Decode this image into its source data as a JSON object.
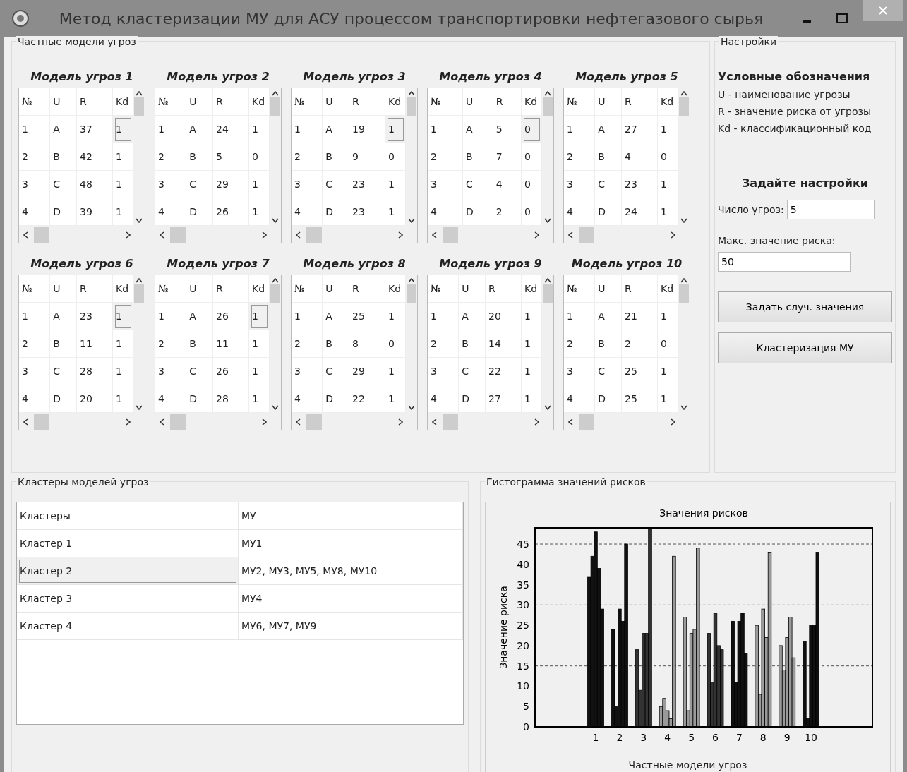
{
  "window": {
    "title": "Метод кластеризации МУ для АСУ процессом транспортировки нефтегазового сырья"
  },
  "models_group": {
    "title": "Частные модели угроз"
  },
  "models": [
    {
      "title": "Модель угроз 1",
      "kd_focused": true,
      "columns": [
        "№",
        "U",
        "R",
        "Kd"
      ],
      "rows": [
        [
          "1",
          "A",
          "37",
          "1"
        ],
        [
          "2",
          "B",
          "42",
          "1"
        ],
        [
          "3",
          "C",
          "48",
          "1"
        ],
        [
          "4",
          "D",
          "39",
          "1"
        ]
      ]
    },
    {
      "title": "Модель угроз 2",
      "kd_focused": false,
      "columns": [
        "№",
        "U",
        "R",
        "Kd"
      ],
      "rows": [
        [
          "1",
          "A",
          "24",
          "1"
        ],
        [
          "2",
          "B",
          "5",
          "0"
        ],
        [
          "3",
          "C",
          "29",
          "1"
        ],
        [
          "4",
          "D",
          "26",
          "1"
        ]
      ]
    },
    {
      "title": "Модель угроз 3",
      "kd_focused": true,
      "columns": [
        "№",
        "U",
        "R",
        "Kd"
      ],
      "rows": [
        [
          "1",
          "A",
          "19",
          "1"
        ],
        [
          "2",
          "B",
          "9",
          "0"
        ],
        [
          "3",
          "C",
          "23",
          "1"
        ],
        [
          "4",
          "D",
          "23",
          "1"
        ]
      ]
    },
    {
      "title": "Модель угроз 4",
      "kd_focused": true,
      "columns": [
        "№",
        "U",
        "R",
        "Kd"
      ],
      "rows": [
        [
          "1",
          "A",
          "5",
          "0"
        ],
        [
          "2",
          "B",
          "7",
          "0"
        ],
        [
          "3",
          "C",
          "4",
          "0"
        ],
        [
          "4",
          "D",
          "2",
          "0"
        ]
      ]
    },
    {
      "title": "Модель угроз 5",
      "kd_focused": false,
      "columns": [
        "№",
        "U",
        "R",
        "Kd"
      ],
      "rows": [
        [
          "1",
          "A",
          "27",
          "1"
        ],
        [
          "2",
          "B",
          "4",
          "0"
        ],
        [
          "3",
          "C",
          "23",
          "1"
        ],
        [
          "4",
          "D",
          "24",
          "1"
        ]
      ]
    },
    {
      "title": "Модель угроз 6",
      "kd_focused": true,
      "columns": [
        "№",
        "U",
        "R",
        "Kd"
      ],
      "rows": [
        [
          "1",
          "A",
          "23",
          "1"
        ],
        [
          "2",
          "B",
          "11",
          "1"
        ],
        [
          "3",
          "C",
          "28",
          "1"
        ],
        [
          "4",
          "D",
          "20",
          "1"
        ]
      ]
    },
    {
      "title": "Модель угроз 7",
      "kd_focused": true,
      "columns": [
        "№",
        "U",
        "R",
        "Kd"
      ],
      "rows": [
        [
          "1",
          "A",
          "26",
          "1"
        ],
        [
          "2",
          "B",
          "11",
          "1"
        ],
        [
          "3",
          "C",
          "26",
          "1"
        ],
        [
          "4",
          "D",
          "28",
          "1"
        ]
      ]
    },
    {
      "title": "Модель угроз 8",
      "kd_focused": false,
      "columns": [
        "№",
        "U",
        "R",
        "Kd"
      ],
      "rows": [
        [
          "1",
          "A",
          "25",
          "1"
        ],
        [
          "2",
          "B",
          "8",
          "0"
        ],
        [
          "3",
          "C",
          "29",
          "1"
        ],
        [
          "4",
          "D",
          "22",
          "1"
        ]
      ]
    },
    {
      "title": "Модель угроз 9",
      "kd_focused": false,
      "columns": [
        "№",
        "U",
        "R",
        "Kd"
      ],
      "rows": [
        [
          "1",
          "A",
          "20",
          "1"
        ],
        [
          "2",
          "B",
          "14",
          "1"
        ],
        [
          "3",
          "C",
          "22",
          "1"
        ],
        [
          "4",
          "D",
          "27",
          "1"
        ]
      ]
    },
    {
      "title": "Модель угроз 10",
      "kd_focused": false,
      "columns": [
        "№",
        "U",
        "R",
        "Kd"
      ],
      "rows": [
        [
          "1",
          "A",
          "21",
          "1"
        ],
        [
          "2",
          "B",
          "2",
          "0"
        ],
        [
          "3",
          "C",
          "25",
          "1"
        ],
        [
          "4",
          "D",
          "25",
          "1"
        ]
      ]
    }
  ],
  "settings": {
    "title": "Настройки",
    "legend_title": "Условные обозначения",
    "legend": [
      "U - наименование угрозы",
      "R - значение риска от угрозы",
      "Kd - классификационный код"
    ],
    "setup_title": "Задайте настройки",
    "threat_count_label": "Число угроз:",
    "threat_count": "5",
    "max_risk_label": "Макс. значение риска:",
    "max_risk": "50",
    "buttons": [
      "Задать случ. значения",
      "Кластеризация МУ"
    ]
  },
  "clusters": {
    "title": "Кластеры моделей угроз",
    "rows": [
      {
        "cells": [
          "Кластеры",
          "МУ"
        ],
        "focused": false
      },
      {
        "cells": [
          "Кластер 1",
          "МУ1"
        ],
        "focused": false
      },
      {
        "cells": [
          "Кластер 2",
          "МУ2, МУ3, МУ5, МУ8, МУ10"
        ],
        "focused": true
      },
      {
        "cells": [
          "Кластер 3",
          "МУ4"
        ],
        "focused": false
      },
      {
        "cells": [
          "Кластер 4",
          "МУ6, МУ7, МУ9"
        ],
        "focused": false
      }
    ]
  },
  "histogram": {
    "title": "Гистограмма значений рисков",
    "chart_data": {
      "type": "bar",
      "title": "Значения рисков",
      "xlabel": "Частные модели угроз",
      "ylabel": "Значение риска",
      "categories": [
        "1",
        "2",
        "3",
        "4",
        "5",
        "6",
        "7",
        "8",
        "9",
        "10"
      ],
      "ylim": [
        0,
        49
      ],
      "yticks": [
        0,
        5,
        10,
        15,
        20,
        25,
        30,
        35,
        40,
        45
      ],
      "series": [
        {
          "colors": [
            "#111111",
            "#111111",
            "#333333",
            "#9a9a9a",
            "#9a9a9a",
            "#333333",
            "#111111",
            "#9a9a9a",
            "#9a9a9a",
            "#111111"
          ],
          "values": [
            37,
            24,
            19,
            5,
            27,
            23,
            26,
            25,
            20,
            21
          ]
        },
        {
          "colors": [
            "#111111",
            "#111111",
            "#333333",
            "#9a9a9a",
            "#9a9a9a",
            "#333333",
            "#111111",
            "#9a9a9a",
            "#9a9a9a",
            "#111111"
          ],
          "values": [
            42,
            5,
            9,
            7,
            4,
            11,
            11,
            8,
            14,
            2
          ]
        },
        {
          "colors": [
            "#111111",
            "#111111",
            "#333333",
            "#9a9a9a",
            "#9a9a9a",
            "#333333",
            "#111111",
            "#9a9a9a",
            "#9a9a9a",
            "#111111"
          ],
          "values": [
            48,
            29,
            23,
            4,
            23,
            28,
            26,
            29,
            22,
            25
          ]
        },
        {
          "colors": [
            "#111111",
            "#111111",
            "#333333",
            "#9a9a9a",
            "#9a9a9a",
            "#333333",
            "#111111",
            "#9a9a9a",
            "#9a9a9a",
            "#111111"
          ],
          "values": [
            39,
            26,
            23,
            2,
            24,
            20,
            28,
            22,
            27,
            25
          ]
        },
        {
          "colors": [
            "#111111",
            "#111111",
            "#333333",
            "#9a9a9a",
            "#9a9a9a",
            "#333333",
            "#111111",
            "#9a9a9a",
            "#9a9a9a",
            "#111111"
          ],
          "values": [
            29,
            45,
            49,
            42,
            44,
            19,
            18,
            43,
            17,
            43
          ]
        }
      ],
      "grid": true
    }
  }
}
